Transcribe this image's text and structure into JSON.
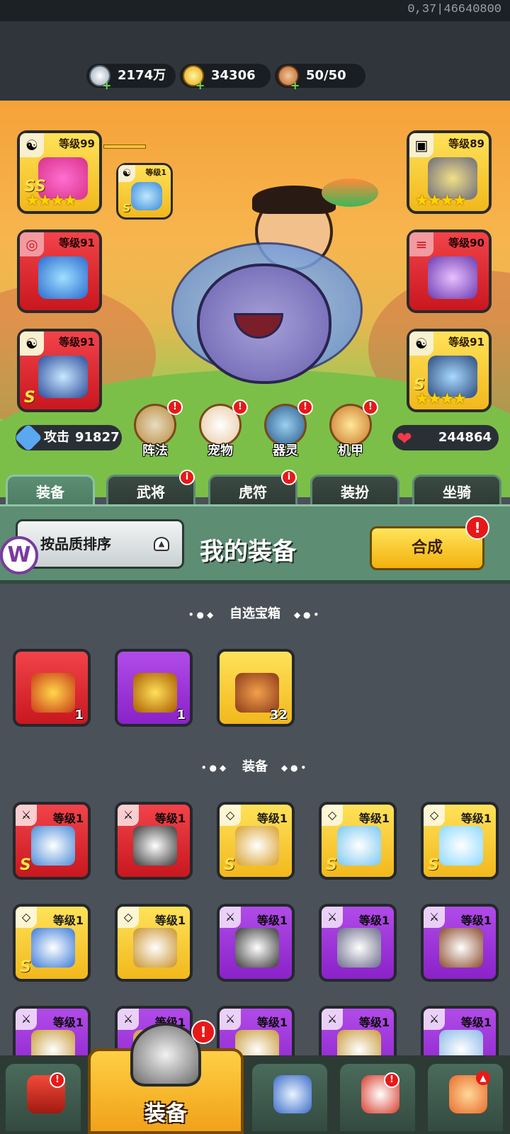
{
  "status": {
    "text": "0,37|46640800"
  },
  "resources": [
    {
      "icon": "silver-coin-icon",
      "value": "2174万"
    },
    {
      "icon": "gold-ingot-icon",
      "value": "34306"
    },
    {
      "icon": "meat-stamina-icon",
      "value": "50/50"
    }
  ],
  "slots": {
    "left1": {
      "level": "等级99",
      "badge": "☯",
      "grade": "SS"
    },
    "left_small": {
      "level": "等级1",
      "badge": "☯",
      "grade": "S"
    },
    "left2": {
      "level": "等级91",
      "badge": "◎"
    },
    "left3": {
      "level": "等级91",
      "badge": "☯",
      "grade": "S"
    },
    "right1": {
      "level": "等级89",
      "badge": "▣"
    },
    "right2": {
      "level": "等级90",
      "badge": "≡"
    },
    "right3": {
      "level": "等级91",
      "badge": "☯",
      "grade": "S"
    }
  },
  "stats": {
    "attack_label": "攻击",
    "attack_value": "91827",
    "hp_value": "244864"
  },
  "features": [
    {
      "label": "阵法",
      "alert": "!"
    },
    {
      "label": "宠物",
      "alert": "!"
    },
    {
      "label": "器灵",
      "alert": "!"
    },
    {
      "label": "机甲",
      "alert": "!"
    }
  ],
  "tabs": [
    {
      "label": "装备"
    },
    {
      "label": "武将",
      "alert": "i"
    },
    {
      "label": "虎符",
      "alert": "i"
    },
    {
      "label": "装扮"
    },
    {
      "label": "坐骑"
    }
  ],
  "panel": {
    "sort_label": "按品质排序",
    "title": "我的装备",
    "merge_label": "合成",
    "merge_alert": "!",
    "logo_letter": "W"
  },
  "sections": {
    "chests": "自选宝箱",
    "equipment": "装备"
  },
  "chests": [
    {
      "count": "1",
      "color": "red"
    },
    {
      "count": "1",
      "color": "purple"
    },
    {
      "count": "32",
      "color": "yellow"
    }
  ],
  "equipment": [
    {
      "level": "等级1",
      "color": "red",
      "grade": "S"
    },
    {
      "level": "等级1",
      "color": "red"
    },
    {
      "level": "等级1",
      "color": "yellow",
      "grade": "S"
    },
    {
      "level": "等级1",
      "color": "yellow",
      "grade": "S"
    },
    {
      "level": "等级1",
      "color": "yellow",
      "grade": "S"
    },
    {
      "level": "等级1",
      "color": "yellow",
      "grade": "S"
    },
    {
      "level": "等级1",
      "color": "yellow"
    },
    {
      "level": "等级1",
      "color": "purple"
    },
    {
      "level": "等级1",
      "color": "purple"
    },
    {
      "level": "等级1",
      "color": "purple"
    },
    {
      "level": "等级1",
      "color": "purple"
    },
    {
      "level": "等级1",
      "color": "purple"
    },
    {
      "level": "等级1",
      "color": "purple"
    },
    {
      "level": "等级1",
      "color": "purple"
    },
    {
      "level": "等级1",
      "color": "purple"
    }
  ],
  "bottom_nav": [
    {
      "icon": "gate-icon",
      "alert": "!"
    },
    {
      "icon": "helmet-icon",
      "label": "装备",
      "alert": "!"
    },
    {
      "icon": "shield-swords-icon"
    },
    {
      "icon": "rooster-icon",
      "alert": "!"
    },
    {
      "icon": "fist-upgrade-icon"
    }
  ]
}
